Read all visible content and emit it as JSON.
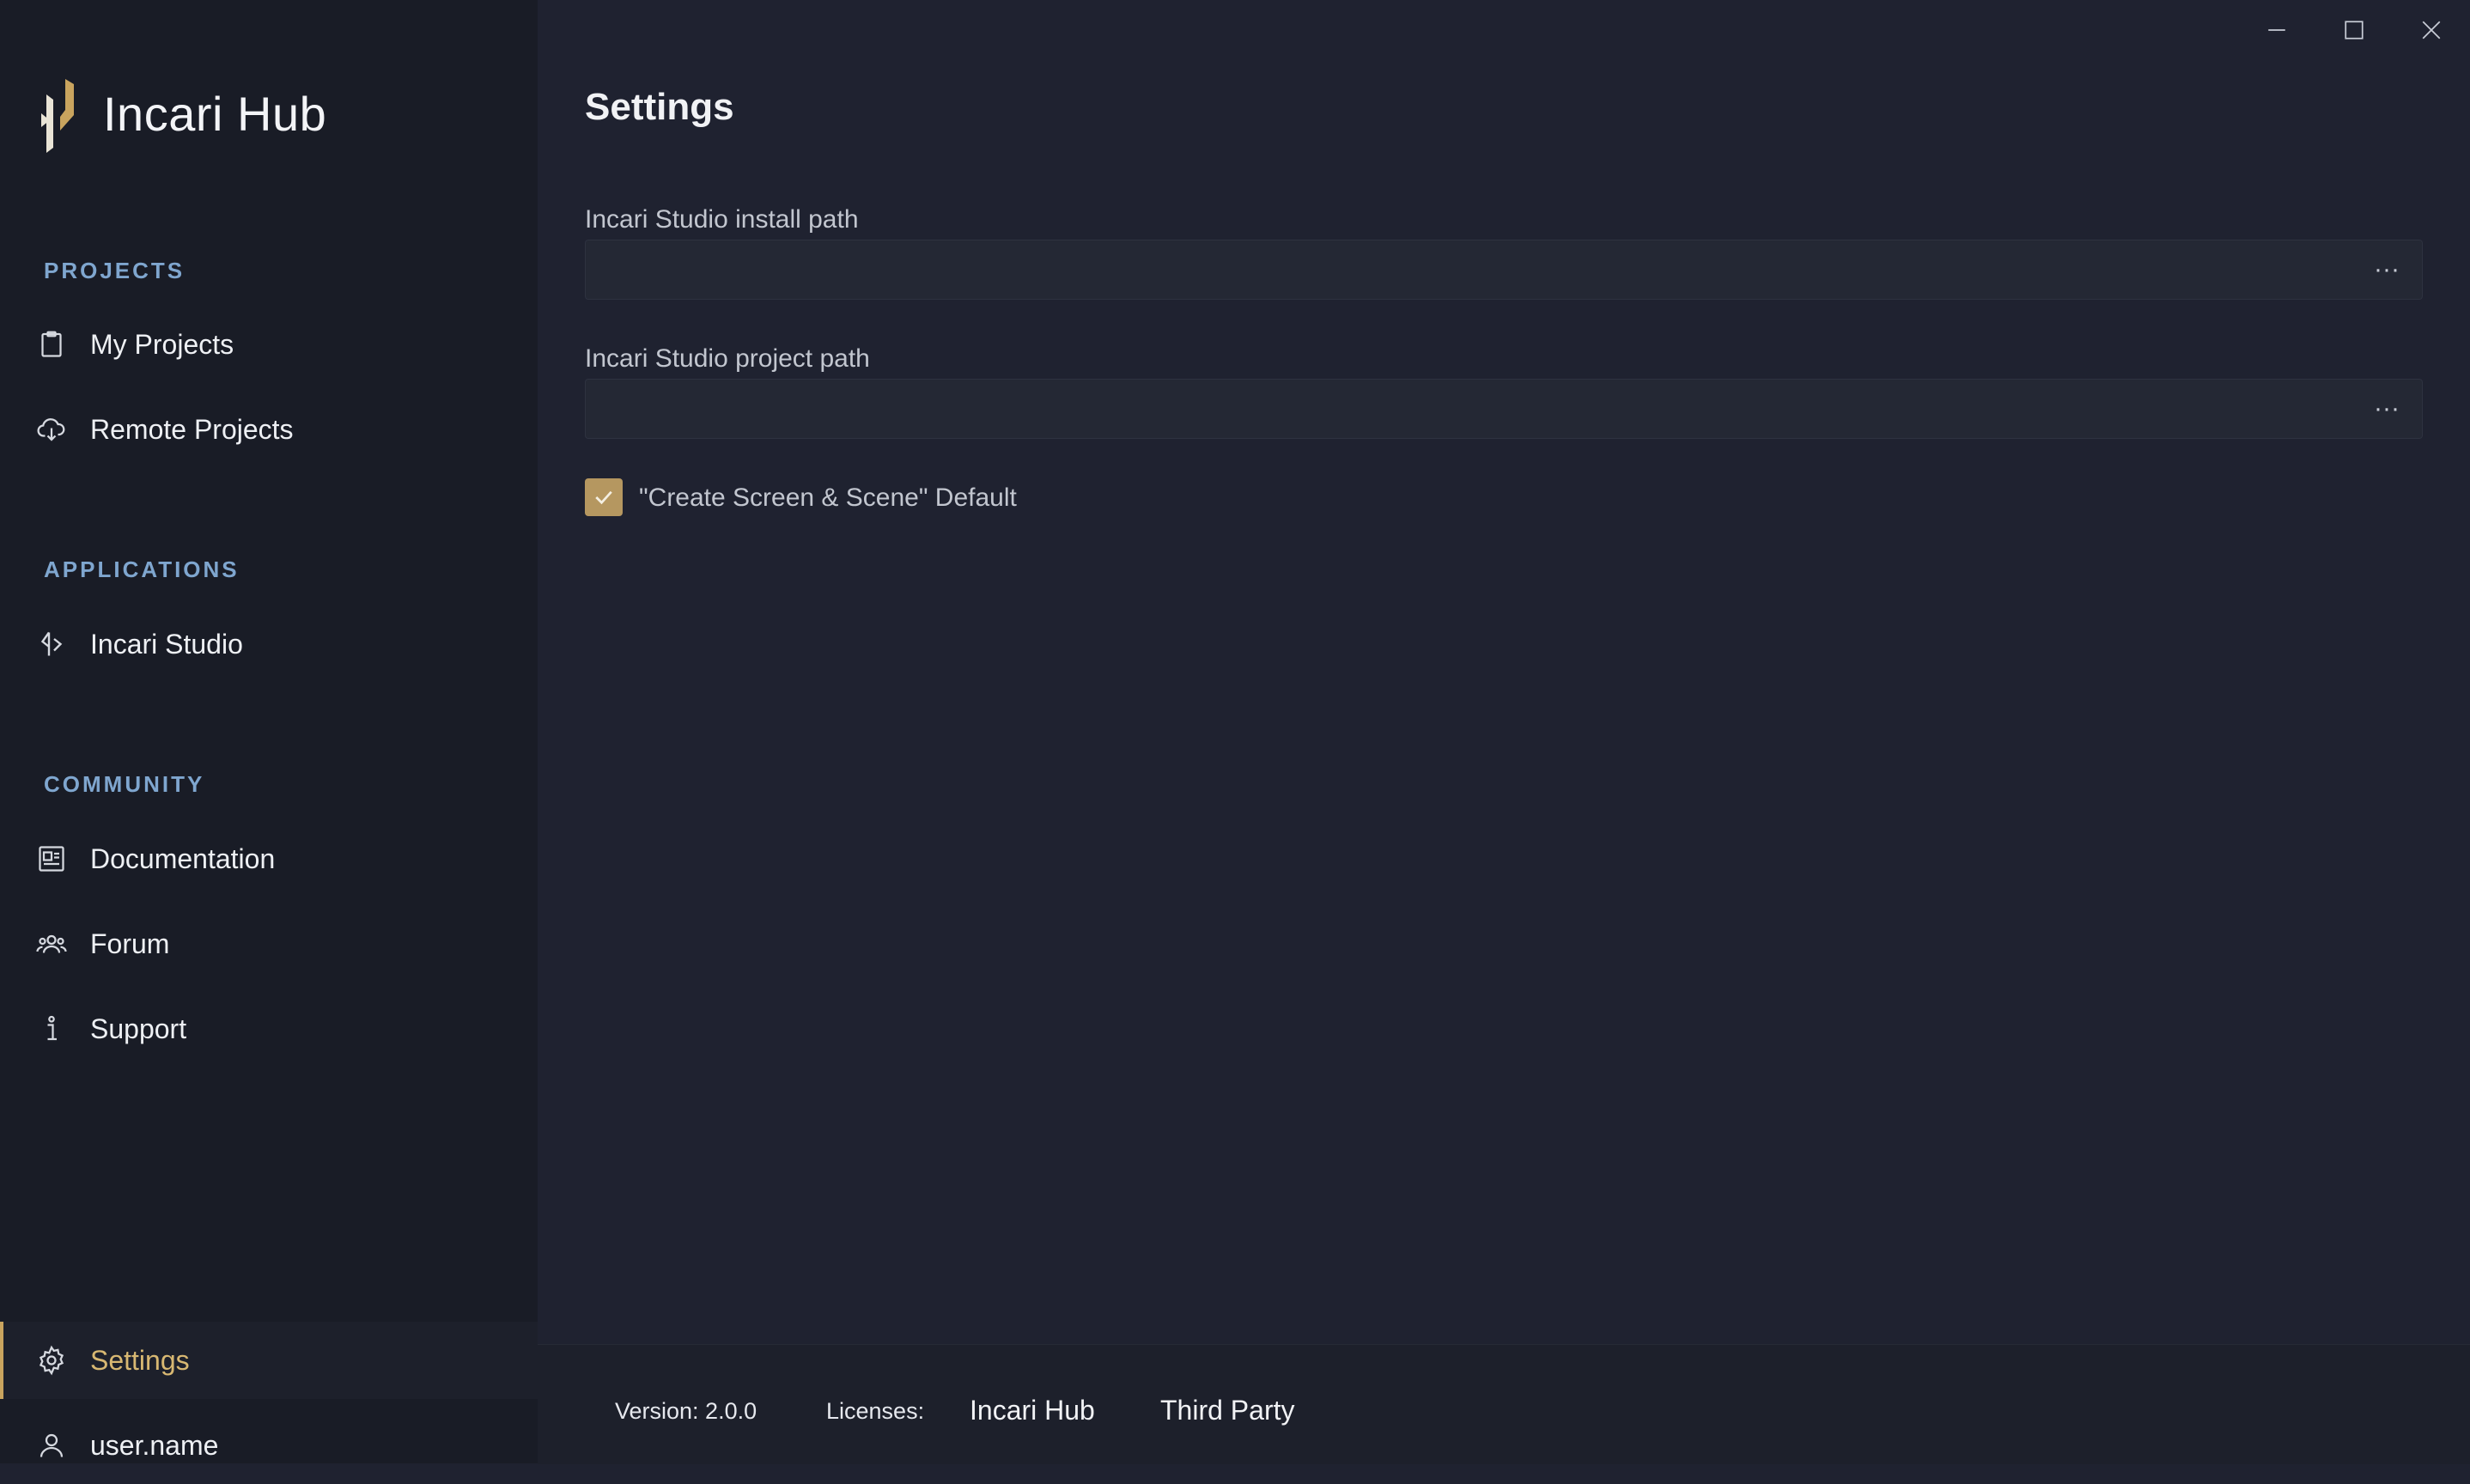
{
  "app": {
    "title": "Incari Hub"
  },
  "sidebar": {
    "sections": {
      "projects": "PROJECTS",
      "applications": "APPLICATIONS",
      "community": "COMMUNITY"
    },
    "items": [
      {
        "label": "My Projects",
        "icon": "clipboard-icon"
      },
      {
        "label": "Remote Projects",
        "icon": "cloud-download-icon"
      },
      {
        "label": "Incari Studio",
        "icon": "incari-studio-icon"
      },
      {
        "label": "Documentation",
        "icon": "document-icon"
      },
      {
        "label": "Forum",
        "icon": "users-icon"
      },
      {
        "label": "Support",
        "icon": "info-icon"
      }
    ],
    "settings": {
      "label": "Settings",
      "icon": "gear-icon",
      "active": true
    },
    "user": {
      "label": "user.name",
      "icon": "user-icon"
    }
  },
  "main": {
    "title": "Settings",
    "install_path": {
      "label": "Incari Studio install path",
      "value": "",
      "browse": "···"
    },
    "project_path": {
      "label": "Incari Studio project path",
      "value": "",
      "browse": "···"
    },
    "create_default": {
      "label": "\"Create Screen & Scene\" Default",
      "checked": true
    }
  },
  "footer": {
    "version": "Version: 2.0.0",
    "licenses_label": "Licenses:",
    "license_links": [
      "Incari Hub",
      "Third Party"
    ]
  },
  "colors": {
    "accent": "#b59760",
    "section_header": "#7fa6cf",
    "background": "#1f2230",
    "sidebar": "#191c26"
  }
}
